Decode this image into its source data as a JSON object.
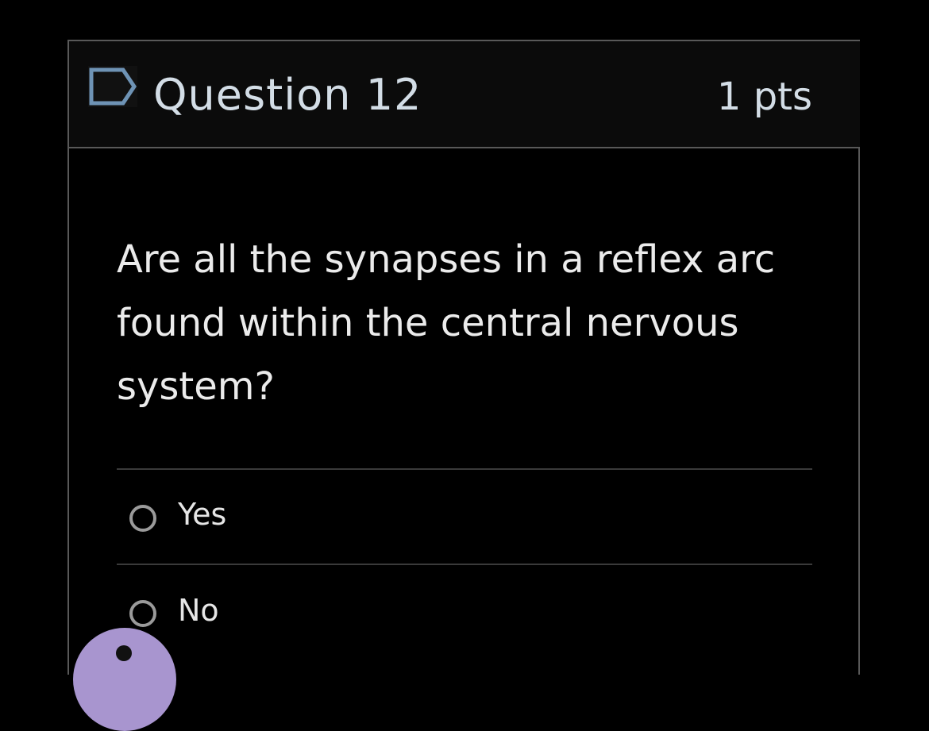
{
  "question": {
    "title": "Question 12",
    "points": "1 pts",
    "text": "Are all the synapses in a reflex arc found within the central nervous system?",
    "flag_icon": "flag-outline-icon"
  },
  "answers": [
    {
      "label": "Yes",
      "selected": false
    },
    {
      "label": "No",
      "selected": false
    }
  ],
  "help_button": {
    "icon": "help-bubble-icon",
    "color": "#a895cf"
  },
  "colors": {
    "background": "#000000",
    "border": "#595959",
    "header_bg": "#0b0b0b",
    "heading_text": "#d3dde6",
    "body_text": "#ebebeb"
  }
}
